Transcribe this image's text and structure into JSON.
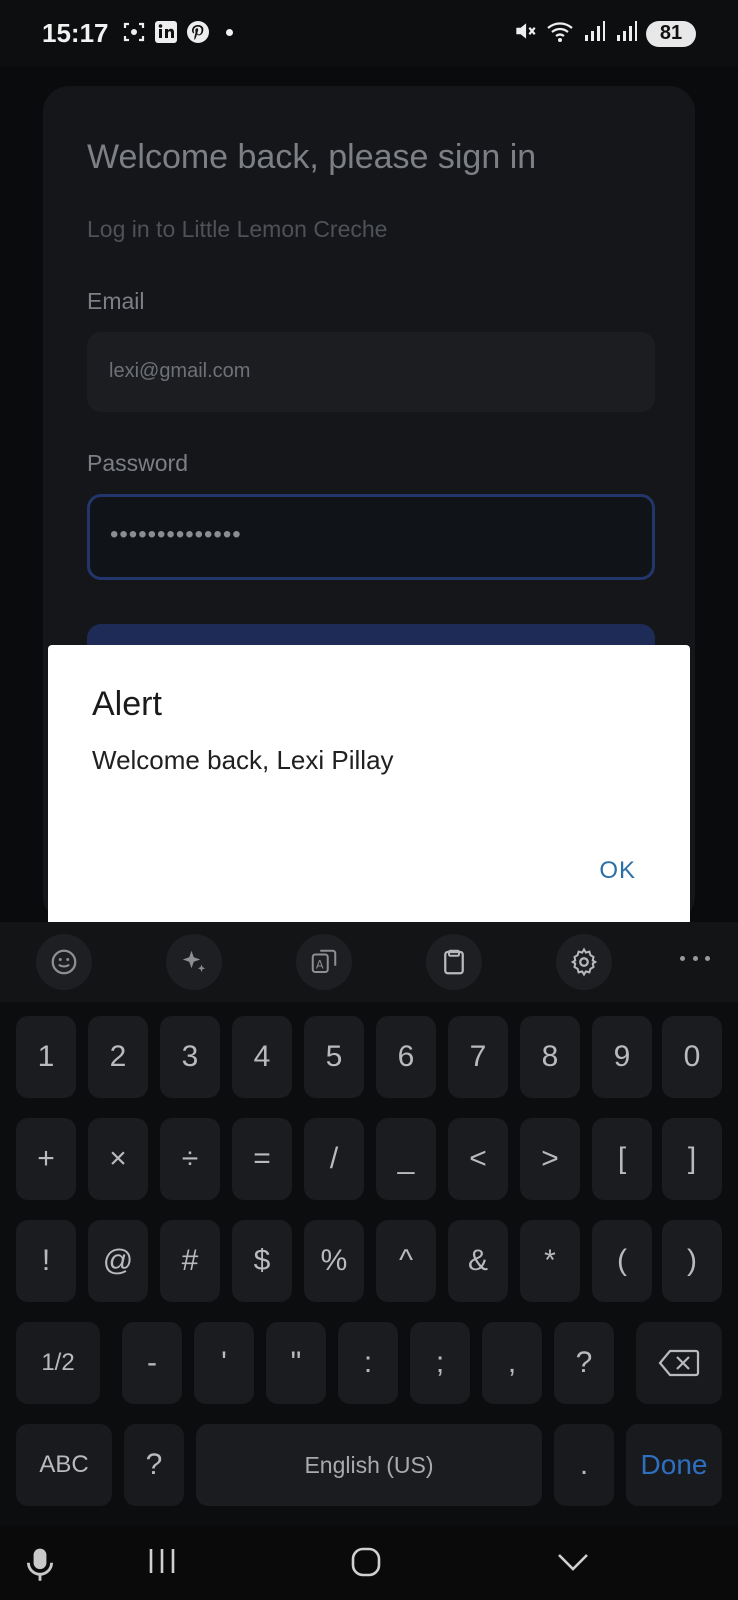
{
  "status_bar": {
    "time": "15:17",
    "notification_icons": [
      "screenshot-icon",
      "linkedin-icon",
      "pinterest-icon"
    ],
    "battery": "81"
  },
  "login_card": {
    "title": "Welcome back, please sign in",
    "subtitle": "Log in to Little Lemon Creche",
    "email_label": "Email",
    "email_value": "lexi@gmail.com",
    "password_label": "Password",
    "password_value": "••••••••••••••"
  },
  "alert": {
    "title": "Alert",
    "message": "Welcome back, Lexi Pillay",
    "ok_label": "OK"
  },
  "keyboard": {
    "toolbar_icons": [
      "emoji-icon",
      "ai-sparkle-icon",
      "translate-icon",
      "clipboard-icon",
      "settings-icon",
      "more-icon"
    ],
    "row1": [
      "1",
      "2",
      "3",
      "4",
      "5",
      "6",
      "7",
      "8",
      "9",
      "0"
    ],
    "row2": [
      "+",
      "×",
      "÷",
      "=",
      "/",
      "_",
      "<",
      ">",
      "[",
      "]"
    ],
    "row3": [
      "!",
      "@",
      "#",
      "$",
      "%",
      "^",
      "&",
      "*",
      "(",
      ")"
    ],
    "row4": [
      "-",
      "'",
      "\"",
      ":",
      ";",
      ",",
      "?"
    ],
    "page_label": "1/2",
    "abc_label": "ABC",
    "question_label": "?",
    "space_label": "English (US)",
    "period_label": ".",
    "done_label": "Done"
  },
  "accent_colors": {
    "ok": "#2a6fa8",
    "done": "#2f6fc0",
    "focused_border": "#22366b"
  }
}
